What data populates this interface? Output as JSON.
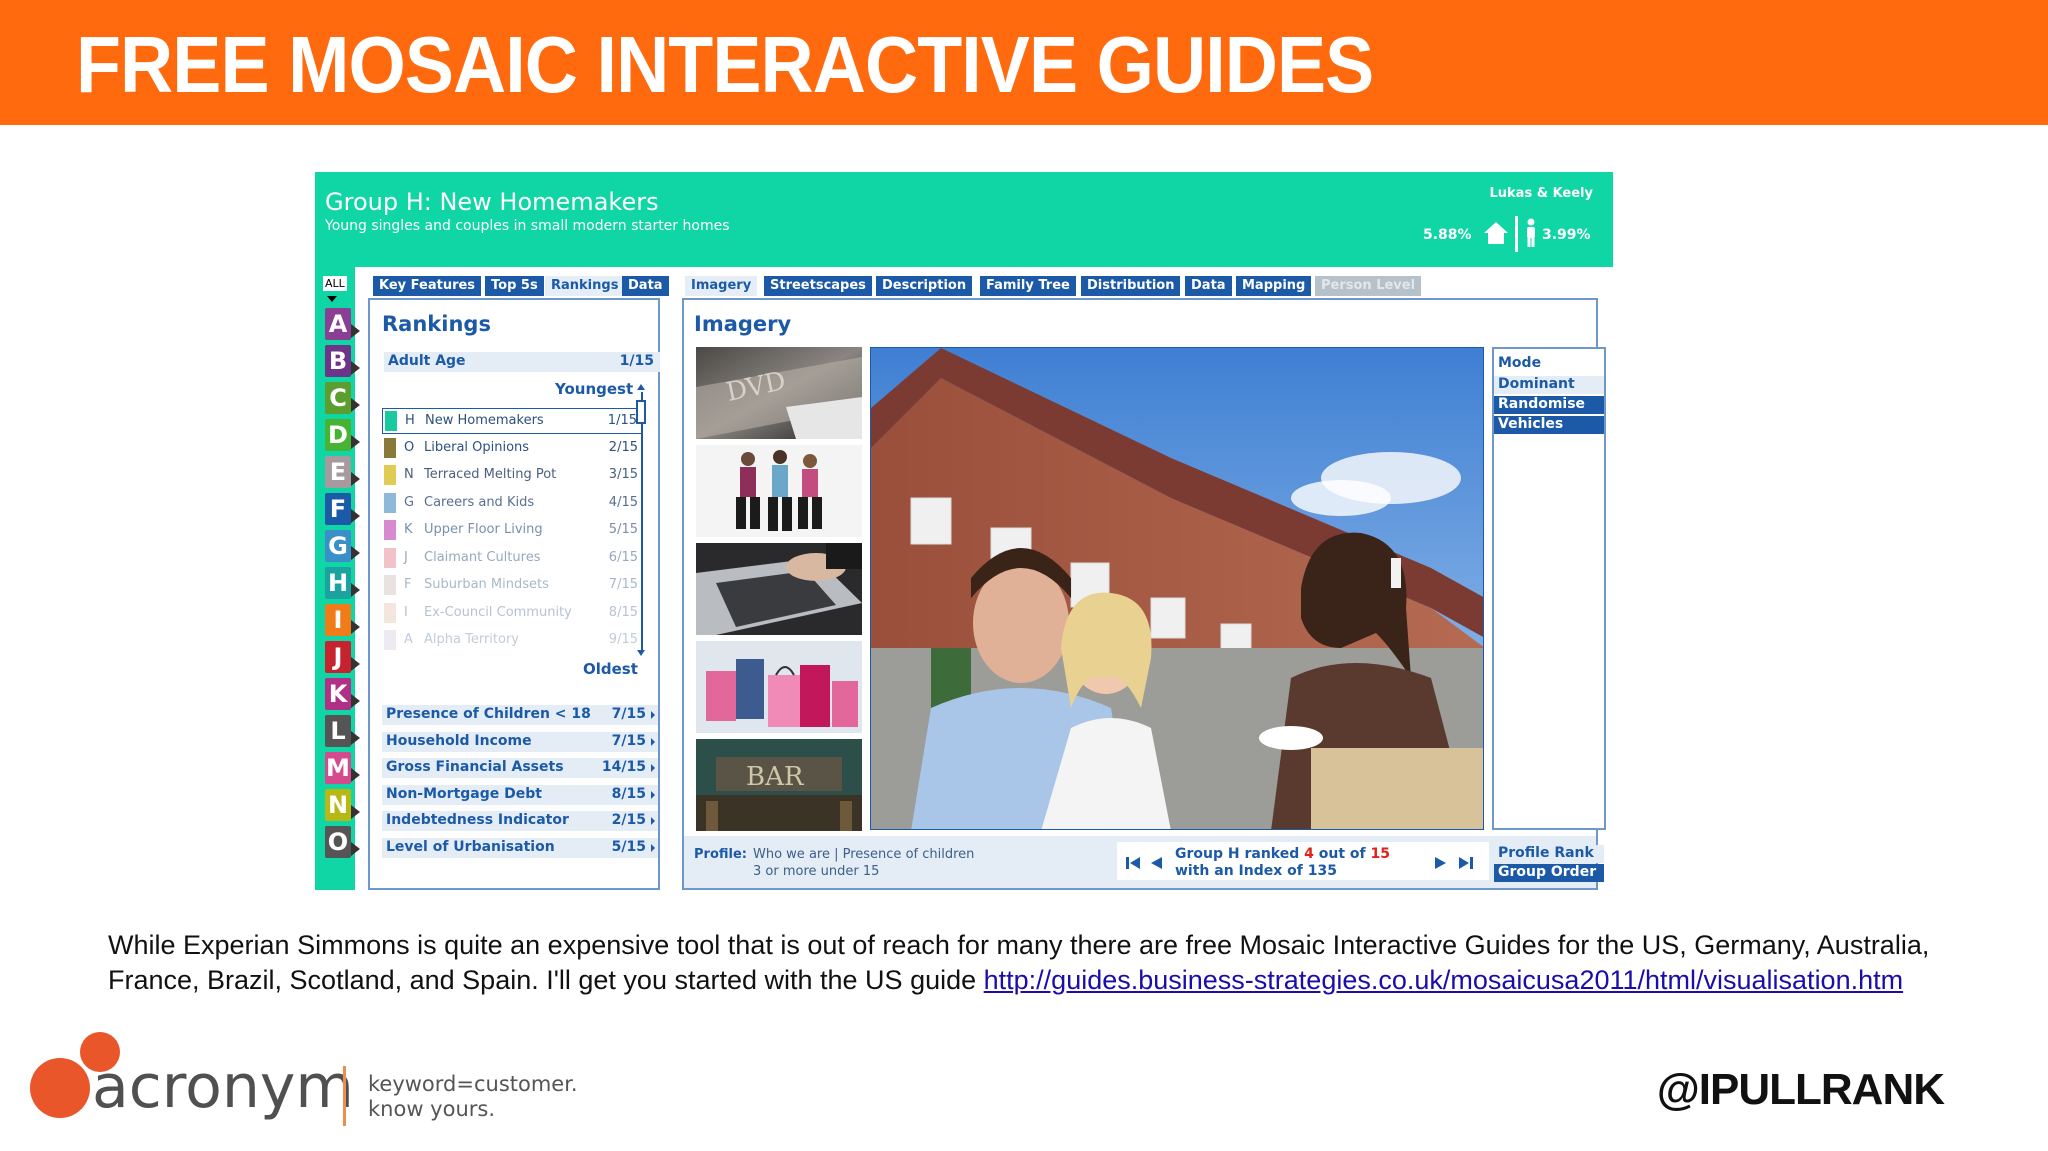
{
  "slide": {
    "title": "FREE MOSAIC INTERACTIVE GUIDES",
    "body_text": "While Experian Simmons is quite an expensive tool that is out of reach for many there are free Mosaic Interactive Guides for the US, Germany, Australia, France, Brazil, Scotland, and Spain. I'll get you started with the US guide ",
    "link_text": "http://guides.business-strategies.co.uk/mosaicusa2011/html/visualisation.htm",
    "handle": "@IPULLRANK",
    "accent_color": "#ff6a0e"
  },
  "logo": {
    "name": "acronym",
    "tagline_line1": "keyword=customer.",
    "tagline_line2": "know yours."
  },
  "app": {
    "group_title": "Group H: New Homemakers",
    "group_subtitle": "Young singles and couples in small modern starter homes",
    "persona_name": "Lukas & Keely",
    "households_pct": "5.88%",
    "persons_pct": "3.99%",
    "all_label": "ALL",
    "letters": [
      "A",
      "B",
      "C",
      "D",
      "E",
      "F",
      "G",
      "H",
      "I",
      "J",
      "K",
      "L",
      "M",
      "N",
      "O"
    ],
    "left_tabs": [
      "Key Features",
      "Top 5s",
      "Rankings",
      "Data"
    ],
    "right_tabs": [
      "Imagery",
      "Streetscapes",
      "Description",
      "Family Tree",
      "Distribution",
      "Data",
      "Mapping",
      "Person Level"
    ],
    "rankings": {
      "title": "Rankings",
      "header_label": "Adult Age",
      "header_value": "1/15",
      "top_label": "Youngest",
      "bottom_label": "Oldest",
      "rows": [
        {
          "code": "H",
          "name": "New Homemakers",
          "value": "1/15"
        },
        {
          "code": "O",
          "name": "Liberal Opinions",
          "value": "2/15"
        },
        {
          "code": "N",
          "name": "Terraced Melting Pot",
          "value": "3/15"
        },
        {
          "code": "G",
          "name": "Careers and Kids",
          "value": "4/15"
        },
        {
          "code": "K",
          "name": "Upper Floor Living",
          "value": "5/15"
        },
        {
          "code": "J",
          "name": "Claimant Cultures",
          "value": "6/15"
        },
        {
          "code": "F",
          "name": "Suburban Mindsets",
          "value": "7/15"
        },
        {
          "code": "I",
          "name": "Ex-Council Community",
          "value": "8/15"
        },
        {
          "code": "A",
          "name": "Alpha Territory",
          "value": "9/15"
        }
      ],
      "metrics": [
        {
          "label": "Presence of Children < 18",
          "value": "7/15"
        },
        {
          "label": "Household Income",
          "value": "7/15"
        },
        {
          "label": "Gross Financial Assets",
          "value": "14/15"
        },
        {
          "label": "Non-Mortgage Debt",
          "value": "8/15"
        },
        {
          "label": "Indebtedness Indicator",
          "value": "2/15"
        },
        {
          "label": "Level of Urbanisation",
          "value": "5/15"
        }
      ]
    },
    "imagery": {
      "title": "Imagery",
      "mode_label": "Mode",
      "mode_options": [
        "Dominant",
        "Randomise",
        "Vehicles"
      ],
      "thumb_dvd": "DVD",
      "thumb_bar": "BAR"
    },
    "profile": {
      "label": "Profile:",
      "line1": "Who we are | Presence of children",
      "line2": "3 or more under 15",
      "rank_prefix": "Group H ranked ",
      "rank_num": "4",
      "rank_mid": " out of ",
      "rank_total": "15",
      "rank_line2": "with an Index of 135",
      "sort_options": [
        "Profile Rank",
        "Group Order"
      ]
    }
  }
}
